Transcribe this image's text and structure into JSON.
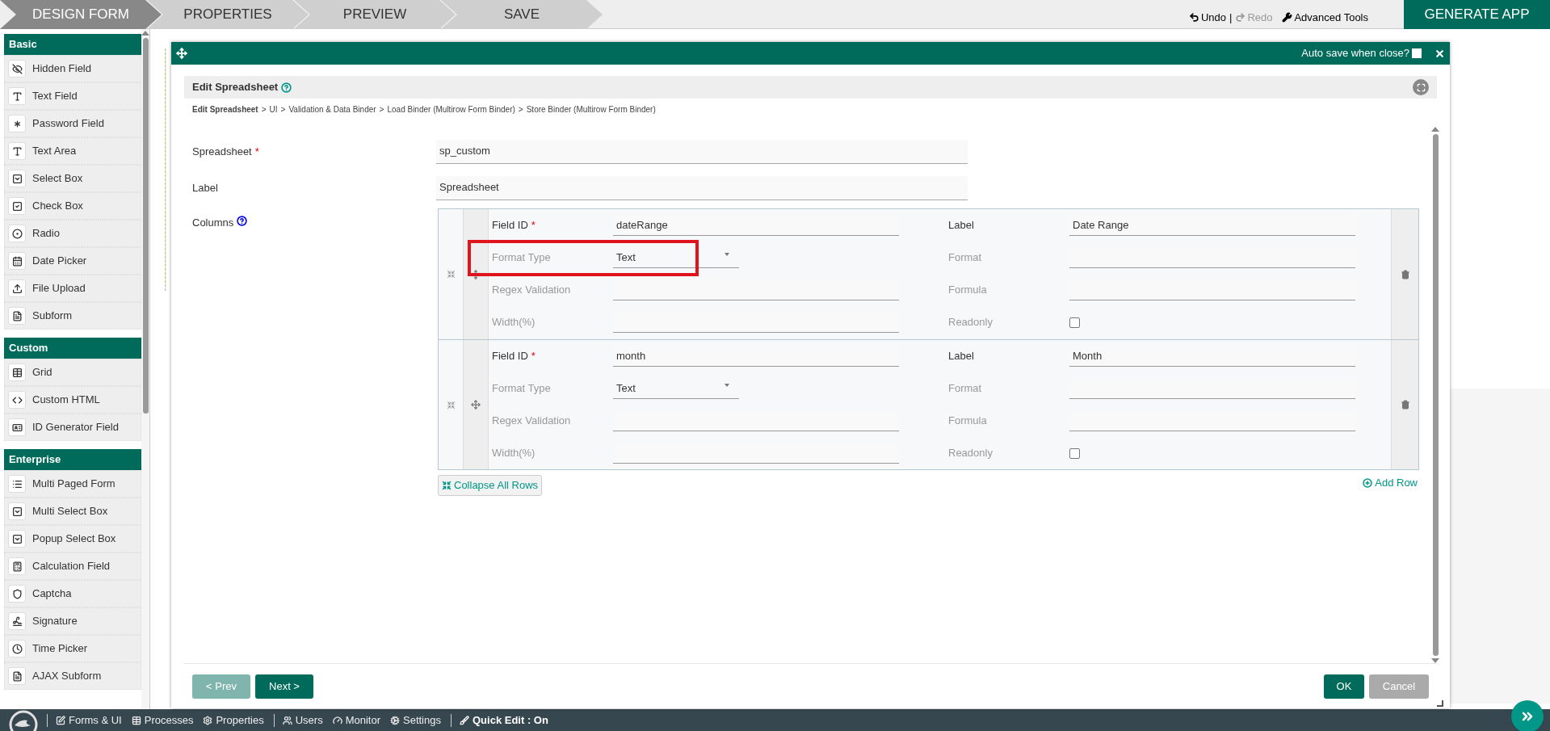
{
  "steps": [
    {
      "label": "DESIGN FORM",
      "selected": true
    },
    {
      "label": "PROPERTIES",
      "selected": false
    },
    {
      "label": "PREVIEW",
      "selected": false
    },
    {
      "label": "SAVE",
      "selected": false
    }
  ],
  "toolbar": {
    "undo": {
      "label": "Undo",
      "disabled": false
    },
    "separator": "|",
    "redo": {
      "label": "Redo",
      "disabled": true
    },
    "advanced_tools": "Advanced Tools",
    "generate_app": "GENERATE APP"
  },
  "palette": [
    {
      "title": "Basic",
      "items": [
        {
          "label": "Hidden Field"
        },
        {
          "label": "Text Field"
        },
        {
          "label": "Password Field"
        },
        {
          "label": "Text Area"
        },
        {
          "label": "Select Box"
        },
        {
          "label": "Check Box"
        },
        {
          "label": "Radio"
        },
        {
          "label": "Date Picker"
        },
        {
          "label": "File Upload"
        },
        {
          "label": "Subform"
        }
      ]
    },
    {
      "title": "Custom",
      "items": [
        {
          "label": "Grid"
        },
        {
          "label": "Custom HTML"
        },
        {
          "label": "ID Generator Field"
        }
      ]
    },
    {
      "title": "Enterprise",
      "items": [
        {
          "label": "Multi Paged Form"
        },
        {
          "label": "Multi Select Box"
        },
        {
          "label": "Popup Select Box"
        },
        {
          "label": "Calculation Field"
        },
        {
          "label": "Captcha"
        },
        {
          "label": "Signature"
        },
        {
          "label": "Time Picker"
        },
        {
          "label": "AJAX Subform"
        }
      ]
    }
  ],
  "dialog": {
    "auto_save": {
      "label": "Auto save when close?",
      "checked": false
    },
    "title": "Edit Spreadsheet",
    "breadcrumb": [
      {
        "label": "Edit Spreadsheet",
        "selected": true
      },
      {
        "label": "UI",
        "selected": false
      },
      {
        "label": "Validation & Data Binder",
        "selected": false
      },
      {
        "label": "Load Binder (Multirow Form Binder)",
        "selected": false
      },
      {
        "label": "Store Binder (Multirow Form Binder)",
        "selected": false
      }
    ],
    "breadcrumb_separator": ">",
    "fields": [
      {
        "label": "Spreadsheet",
        "required_mark": "*",
        "value": "sp_custom"
      },
      {
        "label": "Label",
        "value": "Spreadsheet"
      }
    ],
    "columns_label": "Columns",
    "rows": [
      {
        "left": [
          {
            "label": "Field ID",
            "required_mark": "*",
            "kind": "text",
            "value": "dateRange",
            "highlighted": false
          },
          {
            "label": "Format Type",
            "kind": "select",
            "value": "Text",
            "highlighted": true
          },
          {
            "label": "Regex Validation",
            "kind": "text",
            "highlighted": false
          },
          {
            "label": "Width(%)",
            "kind": "text",
            "highlighted": false
          }
        ],
        "right": [
          {
            "label": "Label",
            "kind": "text",
            "value": "Date Range",
            "highlighted": false
          },
          {
            "label": "Format",
            "kind": "text",
            "highlighted": false
          },
          {
            "label": "Formula",
            "kind": "text",
            "highlighted": false
          },
          {
            "label": "Readonly",
            "kind": "checkbox",
            "checked": false,
            "highlighted": false
          }
        ]
      },
      {
        "left": [
          {
            "label": "Field ID",
            "required_mark": "*",
            "kind": "text",
            "value": "month",
            "highlighted": false
          },
          {
            "label": "Format Type",
            "kind": "select",
            "value": "Text",
            "highlighted": false
          },
          {
            "label": "Regex Validation",
            "kind": "text",
            "highlighted": false
          },
          {
            "label": "Width(%)",
            "kind": "text",
            "highlighted": false
          }
        ],
        "right": [
          {
            "label": "Label",
            "kind": "text",
            "value": "Month",
            "highlighted": false
          },
          {
            "label": "Format",
            "kind": "text",
            "highlighted": false
          },
          {
            "label": "Formula",
            "kind": "text",
            "highlighted": false
          },
          {
            "label": "Readonly",
            "kind": "checkbox",
            "checked": false,
            "highlighted": false
          }
        ]
      }
    ],
    "collapse_all": "Collapse All Rows",
    "add_row": "Add Row",
    "prev": {
      "label": "< Prev",
      "disabled": true
    },
    "next": {
      "label": "Next >",
      "disabled": false
    },
    "ok": "OK",
    "cancel": "Cancel"
  },
  "taskbar": {
    "groups": [
      {
        "items": [
          {
            "label": "Forms & UI"
          },
          {
            "label": "Processes"
          },
          {
            "label": "Properties"
          }
        ]
      },
      {
        "items": [
          {
            "label": "Users"
          },
          {
            "label": "Monitor"
          },
          {
            "label": "Settings"
          }
        ]
      }
    ],
    "quick_edit": "Quick Edit : On"
  }
}
